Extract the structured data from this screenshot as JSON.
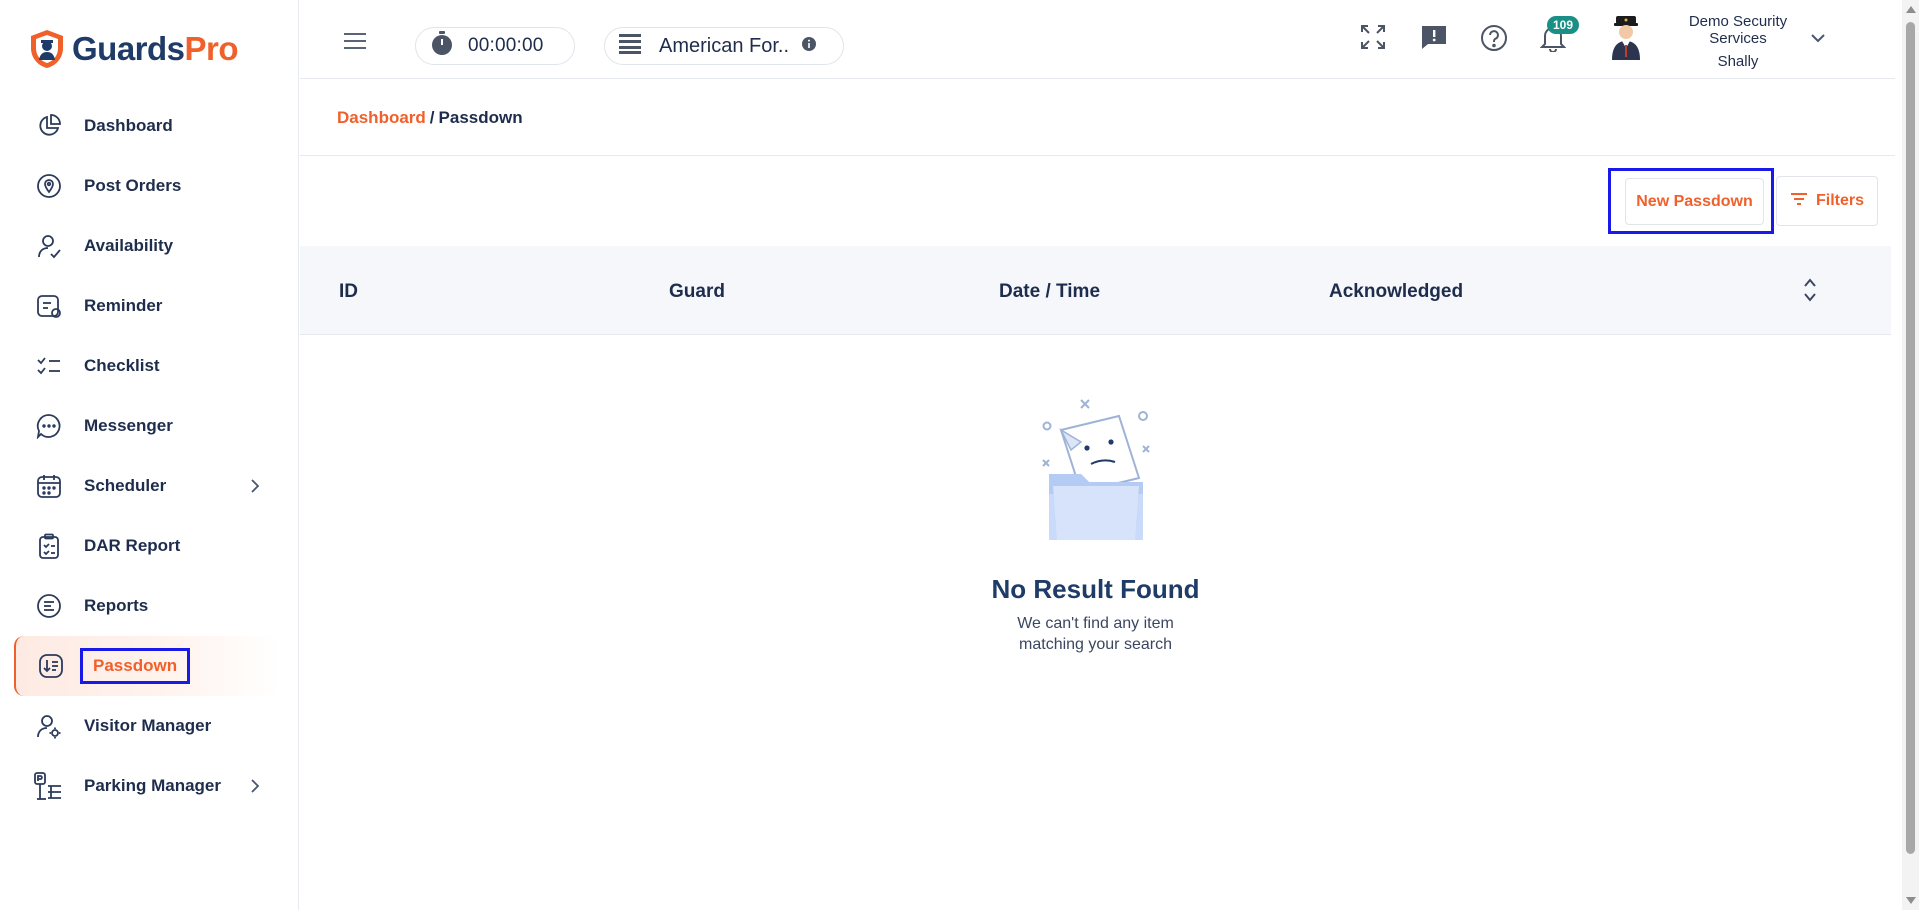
{
  "brand": {
    "name_part1": "Guards",
    "name_part2": "Pro",
    "accent": "#f0602b",
    "navy": "#1f3b67",
    "highlight": "#1a1ae6"
  },
  "sidebar": {
    "items": [
      {
        "label": "Dashboard",
        "icon": "pie-chart-icon"
      },
      {
        "label": "Post Orders",
        "icon": "location-pin-icon"
      },
      {
        "label": "Availability",
        "icon": "user-check-icon"
      },
      {
        "label": "Reminder",
        "icon": "calendar-list-icon"
      },
      {
        "label": "Checklist",
        "icon": "checklist-icon"
      },
      {
        "label": "Messenger",
        "icon": "chat-bubble-icon"
      },
      {
        "label": "Scheduler",
        "icon": "calendar-icon"
      },
      {
        "label": "DAR Report",
        "icon": "clipboard-check-icon"
      },
      {
        "label": "Reports",
        "icon": "report-list-icon"
      },
      {
        "label": "Passdown",
        "icon": "passdown-icon",
        "active": true
      },
      {
        "label": "Visitor Manager",
        "icon": "user-gear-icon"
      },
      {
        "label": "Parking Manager",
        "icon": "parking-icon"
      }
    ]
  },
  "topbar": {
    "timer": "00:00:00",
    "site": "American For..",
    "notifications_count": "109",
    "company": "Demo Security Services",
    "user": "Shally"
  },
  "breadcrumb": {
    "root": "Dashboard",
    "separator": "/",
    "current": "Passdown"
  },
  "actions": {
    "new_label": "New Passdown",
    "filter_label": "Filters"
  },
  "table": {
    "columns": [
      "ID",
      "Guard",
      "Date / Time",
      "Acknowledged"
    ]
  },
  "empty": {
    "title": "No Result Found",
    "subtitle": "We can't find any item matching your search"
  }
}
